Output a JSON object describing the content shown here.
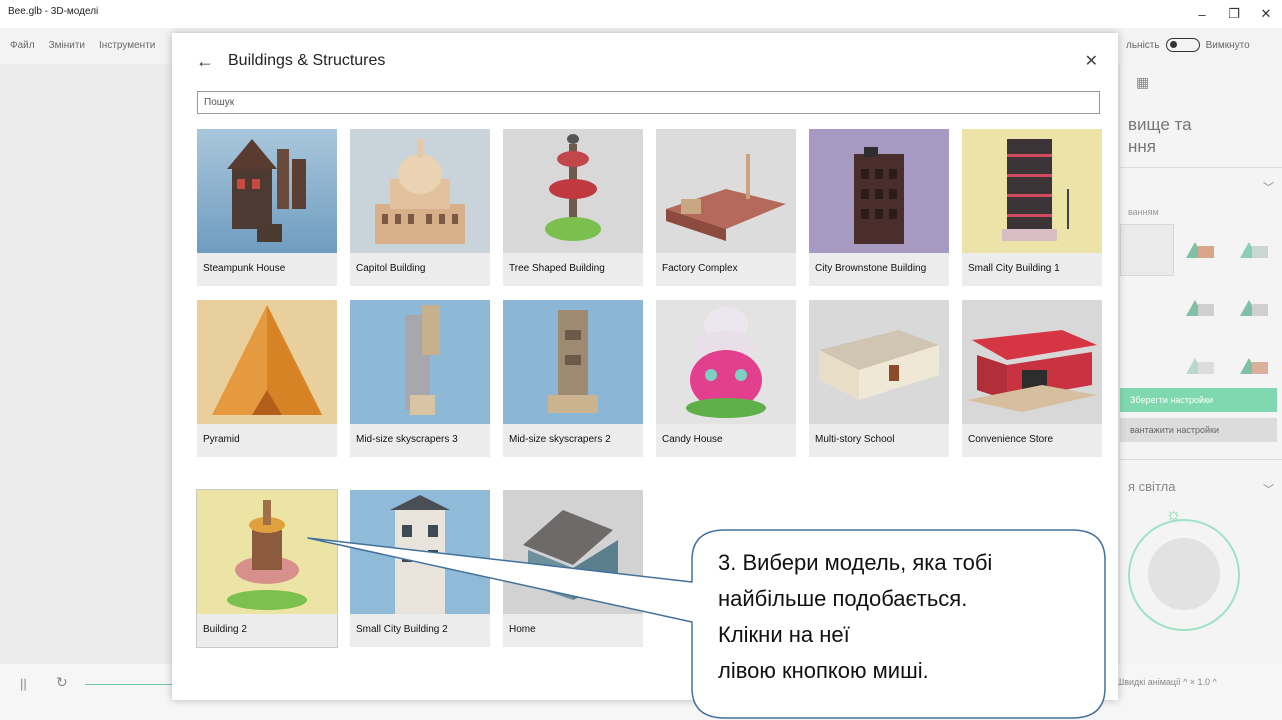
{
  "window": {
    "title": "Bee.glb - 3D-моделі",
    "minimize": "–",
    "maximize": "❐",
    "close": "✕"
  },
  "menu": {
    "items": [
      "Файл",
      "Змінити",
      "Інструменти"
    ],
    "right_label": "льність",
    "right_state": "Вимкнуто"
  },
  "right_panel": {
    "heading_line1": "вище та",
    "heading_line2": "ння",
    "sub_label": "ванням",
    "save_label": "Зберегти настройки",
    "load_label": "вантажити настройки",
    "light_label": "я світла"
  },
  "bottom": {
    "speed_label": "Швидкі анімації ^  × 1.0 ^"
  },
  "dialog": {
    "title": "Buildings & Structures",
    "search_placeholder": "Пошук",
    "models": [
      {
        "label": "Steampunk House"
      },
      {
        "label": "Capitol Building"
      },
      {
        "label": "Tree Shaped Building"
      },
      {
        "label": "Factory Complex"
      },
      {
        "label": "City Brownstone Building"
      },
      {
        "label": "Small City Building 1"
      },
      {
        "label": "Pyramid"
      },
      {
        "label": "Mid-size skyscrapers 3"
      },
      {
        "label": "Mid-size skyscrapers 2"
      },
      {
        "label": "Candy House"
      },
      {
        "label": "Multi-story School"
      },
      {
        "label": "Convenience Store"
      },
      {
        "label": "Building 2"
      },
      {
        "label": "Small City Building 2"
      },
      {
        "label": "Home"
      }
    ]
  },
  "callout": {
    "line1": "3. Вибери модель, яка тобі",
    "line2": "найбільше подобається.",
    "line3": "Клікни на неї",
    "line4": "лівою кнопкою миші."
  },
  "colors": {
    "accent": "#80d8b1",
    "dialog_bg": "#ffffff",
    "callout_stroke": "#41719c"
  }
}
